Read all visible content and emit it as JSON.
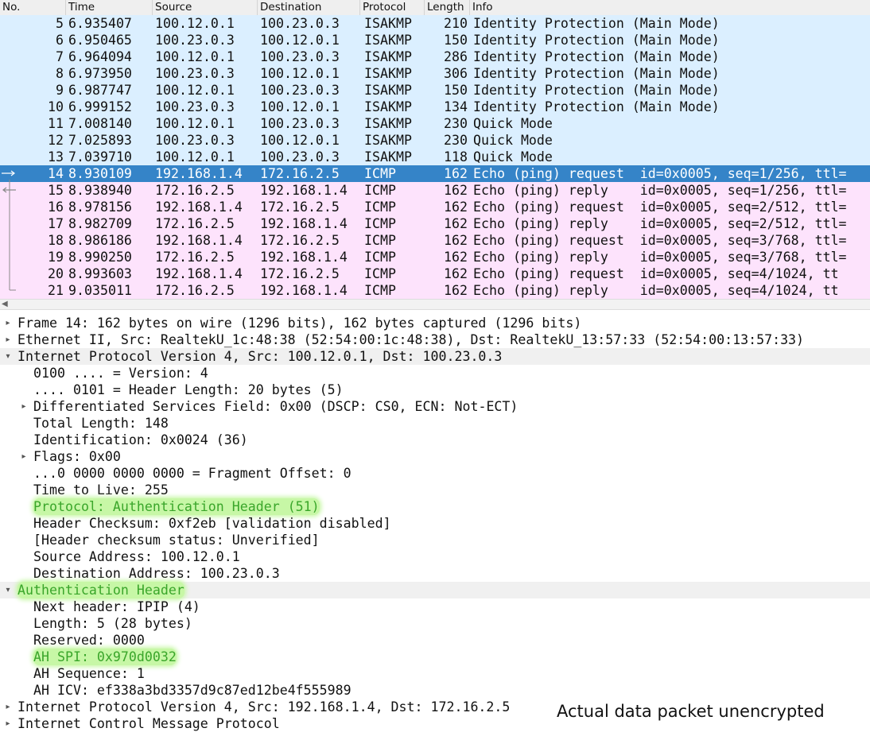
{
  "columns": {
    "no": "No.",
    "time": "Time",
    "source": "Source",
    "destination": "Destination",
    "protocol": "Protocol",
    "length": "Length",
    "info": "Info"
  },
  "colors": {
    "isakmp_row": "#dbefff",
    "icmp_row": "#fde3fc",
    "selected_row": "#3584c8",
    "highlight": "#c7f7a6"
  },
  "packets": [
    {
      "no": "5",
      "time": "6.935407",
      "src": "100.12.0.1",
      "dst": "100.23.0.3",
      "proto": "ISAKMP",
      "len": "210",
      "info": "Identity Protection (Main Mode)",
      "kind": "isakmp"
    },
    {
      "no": "6",
      "time": "6.950465",
      "src": "100.23.0.3",
      "dst": "100.12.0.1",
      "proto": "ISAKMP",
      "len": "150",
      "info": "Identity Protection (Main Mode)",
      "kind": "isakmp"
    },
    {
      "no": "7",
      "time": "6.964094",
      "src": "100.12.0.1",
      "dst": "100.23.0.3",
      "proto": "ISAKMP",
      "len": "286",
      "info": "Identity Protection (Main Mode)",
      "kind": "isakmp"
    },
    {
      "no": "8",
      "time": "6.973950",
      "src": "100.23.0.3",
      "dst": "100.12.0.1",
      "proto": "ISAKMP",
      "len": "306",
      "info": "Identity Protection (Main Mode)",
      "kind": "isakmp"
    },
    {
      "no": "9",
      "time": "6.987747",
      "src": "100.12.0.1",
      "dst": "100.23.0.3",
      "proto": "ISAKMP",
      "len": "150",
      "info": "Identity Protection (Main Mode)",
      "kind": "isakmp"
    },
    {
      "no": "10",
      "time": "6.999152",
      "src": "100.23.0.3",
      "dst": "100.12.0.1",
      "proto": "ISAKMP",
      "len": "134",
      "info": "Identity Protection (Main Mode)",
      "kind": "isakmp"
    },
    {
      "no": "11",
      "time": "7.008140",
      "src": "100.12.0.1",
      "dst": "100.23.0.3",
      "proto": "ISAKMP",
      "len": "230",
      "info": "Quick Mode",
      "kind": "isakmp"
    },
    {
      "no": "12",
      "time": "7.025893",
      "src": "100.23.0.3",
      "dst": "100.12.0.1",
      "proto": "ISAKMP",
      "len": "230",
      "info": "Quick Mode",
      "kind": "isakmp"
    },
    {
      "no": "13",
      "time": "7.039710",
      "src": "100.12.0.1",
      "dst": "100.23.0.3",
      "proto": "ISAKMP",
      "len": "118",
      "info": "Quick Mode",
      "kind": "isakmp"
    },
    {
      "no": "14",
      "time": "8.930109",
      "src": "192.168.1.4",
      "dst": "172.16.2.5",
      "proto": "ICMP",
      "len": "162",
      "info": "Echo (ping) request  id=0x0005, seq=1/256, ttl=",
      "kind": "selected"
    },
    {
      "no": "15",
      "time": "8.938940",
      "src": "172.16.2.5",
      "dst": "192.168.1.4",
      "proto": "ICMP",
      "len": "162",
      "info": "Echo (ping) reply    id=0x0005, seq=1/256, ttl=",
      "kind": "icmp"
    },
    {
      "no": "16",
      "time": "8.978156",
      "src": "192.168.1.4",
      "dst": "172.16.2.5",
      "proto": "ICMP",
      "len": "162",
      "info": "Echo (ping) request  id=0x0005, seq=2/512, ttl=",
      "kind": "icmp"
    },
    {
      "no": "17",
      "time": "8.982709",
      "src": "172.16.2.5",
      "dst": "192.168.1.4",
      "proto": "ICMP",
      "len": "162",
      "info": "Echo (ping) reply    id=0x0005, seq=2/512, ttl=",
      "kind": "icmp"
    },
    {
      "no": "18",
      "time": "8.986186",
      "src": "192.168.1.4",
      "dst": "172.16.2.5",
      "proto": "ICMP",
      "len": "162",
      "info": "Echo (ping) request  id=0x0005, seq=3/768, ttl=",
      "kind": "icmp"
    },
    {
      "no": "19",
      "time": "8.990250",
      "src": "172.16.2.5",
      "dst": "192.168.1.4",
      "proto": "ICMP",
      "len": "162",
      "info": "Echo (ping) reply    id=0x0005, seq=3/768, ttl=",
      "kind": "icmp"
    },
    {
      "no": "20",
      "time": "8.993603",
      "src": "192.168.1.4",
      "dst": "172.16.2.5",
      "proto": "ICMP",
      "len": "162",
      "info": "Echo (ping) request  id=0x0005, seq=4/1024, tt",
      "kind": "icmp"
    },
    {
      "no": "21",
      "time": "9.035011",
      "src": "172.16.2.5",
      "dst": "192.168.1.4",
      "proto": "ICMP",
      "len": "162",
      "info": "Echo (ping) reply    id=0x0005, seq=4/1024, tt",
      "kind": "icmp"
    }
  ],
  "details": [
    {
      "level": 0,
      "toggle": "collapsed",
      "text": "Frame 14: 162 bytes on wire (1296 bits), 162 bytes captured (1296 bits)"
    },
    {
      "level": 0,
      "toggle": "collapsed",
      "text": "Ethernet II, Src: RealtekU_1c:48:38 (52:54:00:1c:48:38), Dst: RealtekU_13:57:33 (52:54:00:13:57:33)"
    },
    {
      "level": 0,
      "toggle": "expanded",
      "text": "Internet Protocol Version 4, Src: 100.12.0.1, Dst: 100.23.0.3"
    },
    {
      "level": 1,
      "toggle": "none",
      "text": "0100 .... = Version: 4"
    },
    {
      "level": 1,
      "toggle": "none",
      "text": ".... 0101 = Header Length: 20 bytes (5)"
    },
    {
      "level": 1,
      "toggle": "collapsed",
      "text": "Differentiated Services Field: 0x00 (DSCP: CS0, ECN: Not-ECT)"
    },
    {
      "level": 1,
      "toggle": "none",
      "text": "Total Length: 148"
    },
    {
      "level": 1,
      "toggle": "none",
      "text": "Identification: 0x0024 (36)"
    },
    {
      "level": 1,
      "toggle": "collapsed",
      "text": "Flags: 0x00"
    },
    {
      "level": 1,
      "toggle": "none",
      "text": "...0 0000 0000 0000 = Fragment Offset: 0"
    },
    {
      "level": 1,
      "toggle": "none",
      "text": "Time to Live: 255"
    },
    {
      "level": 1,
      "toggle": "none",
      "text": "Protocol: Authentication Header (51)",
      "highlight": true
    },
    {
      "level": 1,
      "toggle": "none",
      "text": "Header Checksum: 0xf2eb [validation disabled]"
    },
    {
      "level": 1,
      "toggle": "none",
      "text": "[Header checksum status: Unverified]"
    },
    {
      "level": 1,
      "toggle": "none",
      "text": "Source Address: 100.12.0.1"
    },
    {
      "level": 1,
      "toggle": "none",
      "text": "Destination Address: 100.23.0.3"
    },
    {
      "level": 0,
      "toggle": "expanded",
      "text": "Authentication Header",
      "highlight": true
    },
    {
      "level": 1,
      "toggle": "none",
      "text": "Next header: IPIP (4)"
    },
    {
      "level": 1,
      "toggle": "none",
      "text": "Length: 5 (28 bytes)"
    },
    {
      "level": 1,
      "toggle": "none",
      "text": "Reserved: 0000"
    },
    {
      "level": 1,
      "toggle": "none",
      "text": "AH SPI: 0x970d0032",
      "highlight": true
    },
    {
      "level": 1,
      "toggle": "none",
      "text": "AH Sequence: 1"
    },
    {
      "level": 1,
      "toggle": "none",
      "text": "AH ICV: ef338a3bd3357d9c87ed12be4f555989"
    },
    {
      "level": 0,
      "toggle": "collapsed",
      "text": "Internet Protocol Version 4, Src: 192.168.1.4, Dst: 172.16.2.5"
    },
    {
      "level": 0,
      "toggle": "collapsed",
      "text": "Internet Control Message Protocol"
    }
  ],
  "annotation": "Actual data packet unencrypted"
}
